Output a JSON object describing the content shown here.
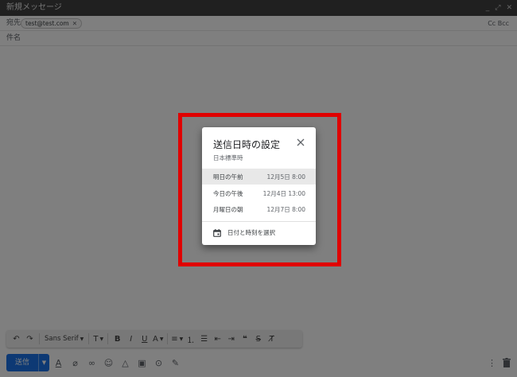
{
  "compose": {
    "title": "新規メッセージ",
    "to_label": "宛先",
    "recipient": "test@test.com",
    "cc_bcc": "Cc Bcc",
    "subject_label": "件名"
  },
  "toolbar": {
    "font": "Sans Serif"
  },
  "send": {
    "label": "送信"
  },
  "dialog": {
    "title": "送信日時の設定",
    "timezone": "日本標準時",
    "options": [
      {
        "label": "明日の午前",
        "date": "12月5日 8:00"
      },
      {
        "label": "今日の午後",
        "date": "12月4日 13:00"
      },
      {
        "label": "月曜日の朝",
        "date": "12月7日 8:00"
      }
    ],
    "pick_label": "日付と時刻を選択"
  },
  "highlight_color": "#e00000",
  "accent": "#1a73e8"
}
